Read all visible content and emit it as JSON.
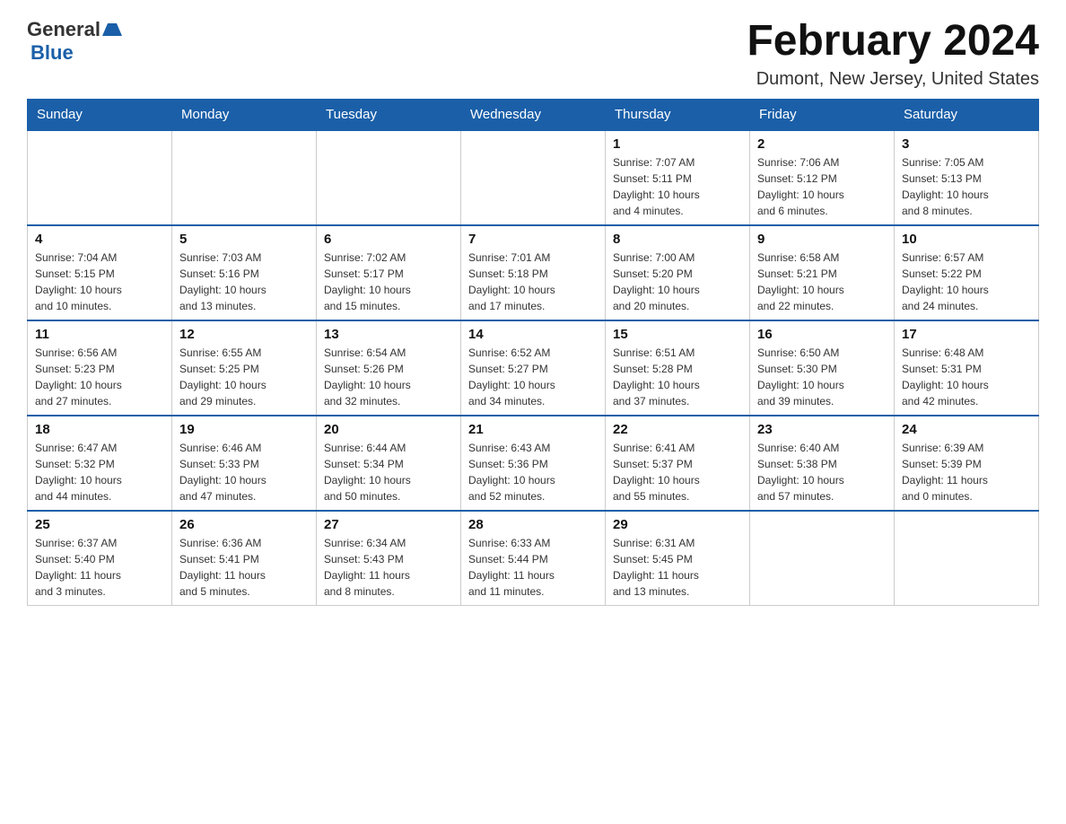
{
  "header": {
    "logo": {
      "general": "General",
      "blue": "Blue"
    },
    "title": "February 2024",
    "location": "Dumont, New Jersey, United States"
  },
  "weekdays": [
    "Sunday",
    "Monday",
    "Tuesday",
    "Wednesday",
    "Thursday",
    "Friday",
    "Saturday"
  ],
  "weeks": [
    [
      {
        "day": "",
        "info": ""
      },
      {
        "day": "",
        "info": ""
      },
      {
        "day": "",
        "info": ""
      },
      {
        "day": "",
        "info": ""
      },
      {
        "day": "1",
        "info": "Sunrise: 7:07 AM\nSunset: 5:11 PM\nDaylight: 10 hours\nand 4 minutes."
      },
      {
        "day": "2",
        "info": "Sunrise: 7:06 AM\nSunset: 5:12 PM\nDaylight: 10 hours\nand 6 minutes."
      },
      {
        "day": "3",
        "info": "Sunrise: 7:05 AM\nSunset: 5:13 PM\nDaylight: 10 hours\nand 8 minutes."
      }
    ],
    [
      {
        "day": "4",
        "info": "Sunrise: 7:04 AM\nSunset: 5:15 PM\nDaylight: 10 hours\nand 10 minutes."
      },
      {
        "day": "5",
        "info": "Sunrise: 7:03 AM\nSunset: 5:16 PM\nDaylight: 10 hours\nand 13 minutes."
      },
      {
        "day": "6",
        "info": "Sunrise: 7:02 AM\nSunset: 5:17 PM\nDaylight: 10 hours\nand 15 minutes."
      },
      {
        "day": "7",
        "info": "Sunrise: 7:01 AM\nSunset: 5:18 PM\nDaylight: 10 hours\nand 17 minutes."
      },
      {
        "day": "8",
        "info": "Sunrise: 7:00 AM\nSunset: 5:20 PM\nDaylight: 10 hours\nand 20 minutes."
      },
      {
        "day": "9",
        "info": "Sunrise: 6:58 AM\nSunset: 5:21 PM\nDaylight: 10 hours\nand 22 minutes."
      },
      {
        "day": "10",
        "info": "Sunrise: 6:57 AM\nSunset: 5:22 PM\nDaylight: 10 hours\nand 24 minutes."
      }
    ],
    [
      {
        "day": "11",
        "info": "Sunrise: 6:56 AM\nSunset: 5:23 PM\nDaylight: 10 hours\nand 27 minutes."
      },
      {
        "day": "12",
        "info": "Sunrise: 6:55 AM\nSunset: 5:25 PM\nDaylight: 10 hours\nand 29 minutes."
      },
      {
        "day": "13",
        "info": "Sunrise: 6:54 AM\nSunset: 5:26 PM\nDaylight: 10 hours\nand 32 minutes."
      },
      {
        "day": "14",
        "info": "Sunrise: 6:52 AM\nSunset: 5:27 PM\nDaylight: 10 hours\nand 34 minutes."
      },
      {
        "day": "15",
        "info": "Sunrise: 6:51 AM\nSunset: 5:28 PM\nDaylight: 10 hours\nand 37 minutes."
      },
      {
        "day": "16",
        "info": "Sunrise: 6:50 AM\nSunset: 5:30 PM\nDaylight: 10 hours\nand 39 minutes."
      },
      {
        "day": "17",
        "info": "Sunrise: 6:48 AM\nSunset: 5:31 PM\nDaylight: 10 hours\nand 42 minutes."
      }
    ],
    [
      {
        "day": "18",
        "info": "Sunrise: 6:47 AM\nSunset: 5:32 PM\nDaylight: 10 hours\nand 44 minutes."
      },
      {
        "day": "19",
        "info": "Sunrise: 6:46 AM\nSunset: 5:33 PM\nDaylight: 10 hours\nand 47 minutes."
      },
      {
        "day": "20",
        "info": "Sunrise: 6:44 AM\nSunset: 5:34 PM\nDaylight: 10 hours\nand 50 minutes."
      },
      {
        "day": "21",
        "info": "Sunrise: 6:43 AM\nSunset: 5:36 PM\nDaylight: 10 hours\nand 52 minutes."
      },
      {
        "day": "22",
        "info": "Sunrise: 6:41 AM\nSunset: 5:37 PM\nDaylight: 10 hours\nand 55 minutes."
      },
      {
        "day": "23",
        "info": "Sunrise: 6:40 AM\nSunset: 5:38 PM\nDaylight: 10 hours\nand 57 minutes."
      },
      {
        "day": "24",
        "info": "Sunrise: 6:39 AM\nSunset: 5:39 PM\nDaylight: 11 hours\nand 0 minutes."
      }
    ],
    [
      {
        "day": "25",
        "info": "Sunrise: 6:37 AM\nSunset: 5:40 PM\nDaylight: 11 hours\nand 3 minutes."
      },
      {
        "day": "26",
        "info": "Sunrise: 6:36 AM\nSunset: 5:41 PM\nDaylight: 11 hours\nand 5 minutes."
      },
      {
        "day": "27",
        "info": "Sunrise: 6:34 AM\nSunset: 5:43 PM\nDaylight: 11 hours\nand 8 minutes."
      },
      {
        "day": "28",
        "info": "Sunrise: 6:33 AM\nSunset: 5:44 PM\nDaylight: 11 hours\nand 11 minutes."
      },
      {
        "day": "29",
        "info": "Sunrise: 6:31 AM\nSunset: 5:45 PM\nDaylight: 11 hours\nand 13 minutes."
      },
      {
        "day": "",
        "info": ""
      },
      {
        "day": "",
        "info": ""
      }
    ]
  ]
}
